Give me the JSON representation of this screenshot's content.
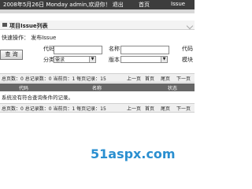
{
  "header": {
    "date": "2008年5月26日",
    "weekday": "Monday",
    "welcome": "admin,欢迎你！",
    "logout": "退出",
    "nav": [
      "首页",
      "Issue"
    ]
  },
  "page": {
    "title": "项目Issue列表",
    "shortcut": "快速操作： 发布Issue"
  },
  "search": {
    "button": "查 询",
    "fields": {
      "code_label": "代码",
      "name_label": "名称",
      "code2_label": "代码",
      "category_label": "分类",
      "category_value": "需求",
      "version_label": "版本",
      "module_label": "模块"
    }
  },
  "pager": {
    "summary": "总页数：0 总记录数：0  当前页：1 每页记录：15",
    "first": "上一页",
    "prev": "首页",
    "next": "尾页",
    "last": "下一页"
  },
  "table": {
    "columns": [
      "代码",
      "名称",
      "状态"
    ],
    "empty_message": "系统没有符合查询条件的记录。"
  },
  "watermark": "51aspx.com"
}
